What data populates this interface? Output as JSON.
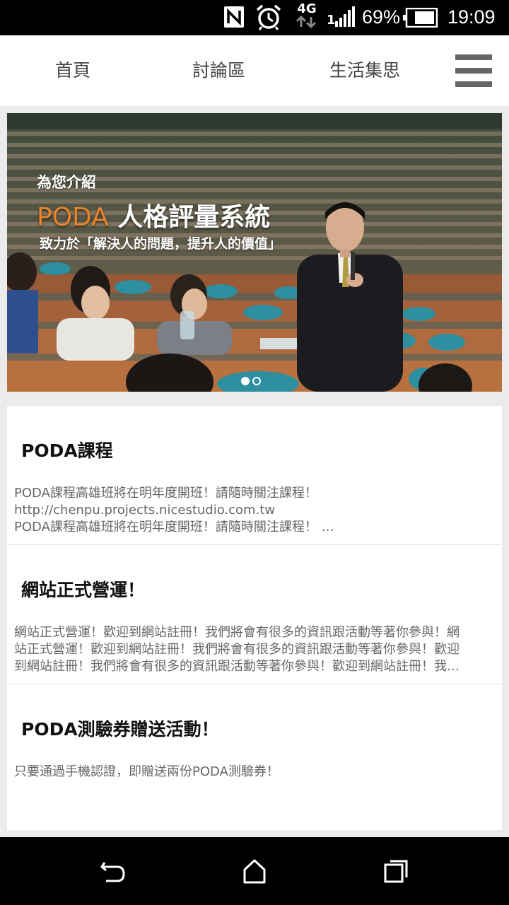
{
  "status_bar": {
    "network_label": "4G",
    "signal_prefix": "1",
    "battery": "69%",
    "time": "19:09",
    "icons": [
      "nfc-icon",
      "alarm-icon",
      "network-4g-icon",
      "signal-icon",
      "battery-icon"
    ]
  },
  "nav": {
    "tabs": [
      {
        "label": "首頁"
      },
      {
        "label": "討論區"
      },
      {
        "label": "生活集思"
      }
    ],
    "menu_icon": "hamburger-menu-icon"
  },
  "banner": {
    "subtitle": "為您介紹",
    "title_accent": "PODA",
    "title_rest": " 人格評量系統",
    "tagline": "致力於「解決人的問題，提升人的價值」",
    "slides": 2,
    "active_slide": 1
  },
  "news": [
    {
      "title": "PODA課程",
      "lines": [
        "PODA課程高雄班將在明年度開班！請隨時關注課程！",
        "http://chenpu.projects.nicestudio.com.tw",
        "PODA課程高雄班將在明年度開班！請隨時關注課程！ …"
      ]
    },
    {
      "title": "網站正式營運！",
      "lines": [
        "網站正式營運！歡迎到網站註冊！我們將會有很多的資訊跟活動等著你參與！網",
        "站正式營運！歡迎到網站註冊！我們將會有很多的資訊跟活動等著你參與！歡迎",
        "到網站註冊！我們將會有很多的資訊跟活動等著你參與！歡迎到網站註冊！我…"
      ]
    },
    {
      "title": "PODA測驗券贈送活動！",
      "lines": [
        "只要通過手機認證，即贈送兩份PODA測驗券！"
      ]
    }
  ],
  "system_nav": {
    "icons": [
      "back-icon",
      "home-icon",
      "recents-icon"
    ]
  },
  "colors": {
    "accent": "#e8832b",
    "background": "#ebebeb",
    "card": "#ffffff"
  }
}
